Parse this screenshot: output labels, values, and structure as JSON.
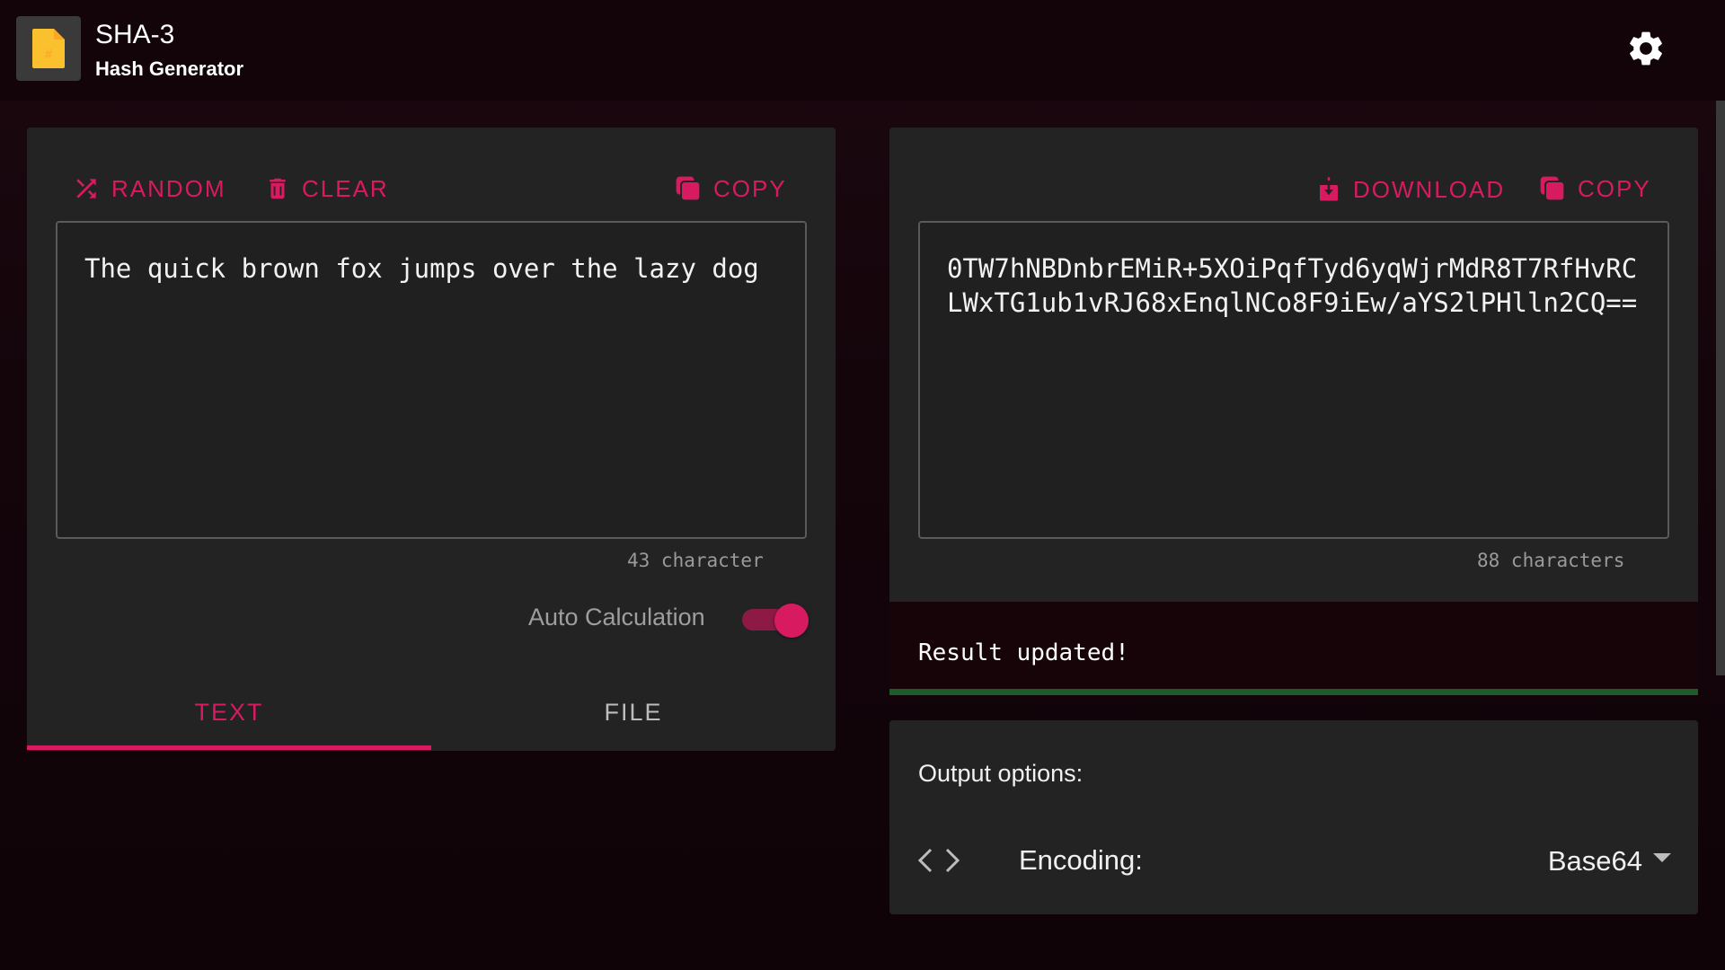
{
  "app": {
    "title": "SHA-3",
    "subtitle": "Hash Generator",
    "icon": "file-hash-icon",
    "settings_icon": "gear-icon"
  },
  "input_panel": {
    "random_label": "RANDOM",
    "clear_label": "CLEAR",
    "copy_label": "COPY",
    "text_value": "The quick brown fox jumps over the lazy dog",
    "char_count": "43 character",
    "auto_calc_label": "Auto Calculation",
    "auto_calc_on": true,
    "tabs": [
      {
        "label": "TEXT",
        "active": true
      },
      {
        "label": "FILE",
        "active": false
      }
    ]
  },
  "output_panel": {
    "download_label": "DOWNLOAD",
    "copy_label": "COPY",
    "hash_value": "0TW7hNBDnbrEMiR+5XOiPqfTyd6yqWjrMdR8T7RfHvRCLWxTG1ub1vRJ68xEnqlNCo8F9iEw/aYS2lPHlln2CQ==",
    "char_count": "88 characters"
  },
  "snackbar": {
    "message": "Result updated!"
  },
  "output_options": {
    "title": "Output options:",
    "encoding_label": "Encoding:",
    "encoding_value": "Base64"
  },
  "colors": {
    "accent": "#d81b60",
    "card": "#232323",
    "background": "#14050b",
    "success": "#1f5a2a"
  }
}
